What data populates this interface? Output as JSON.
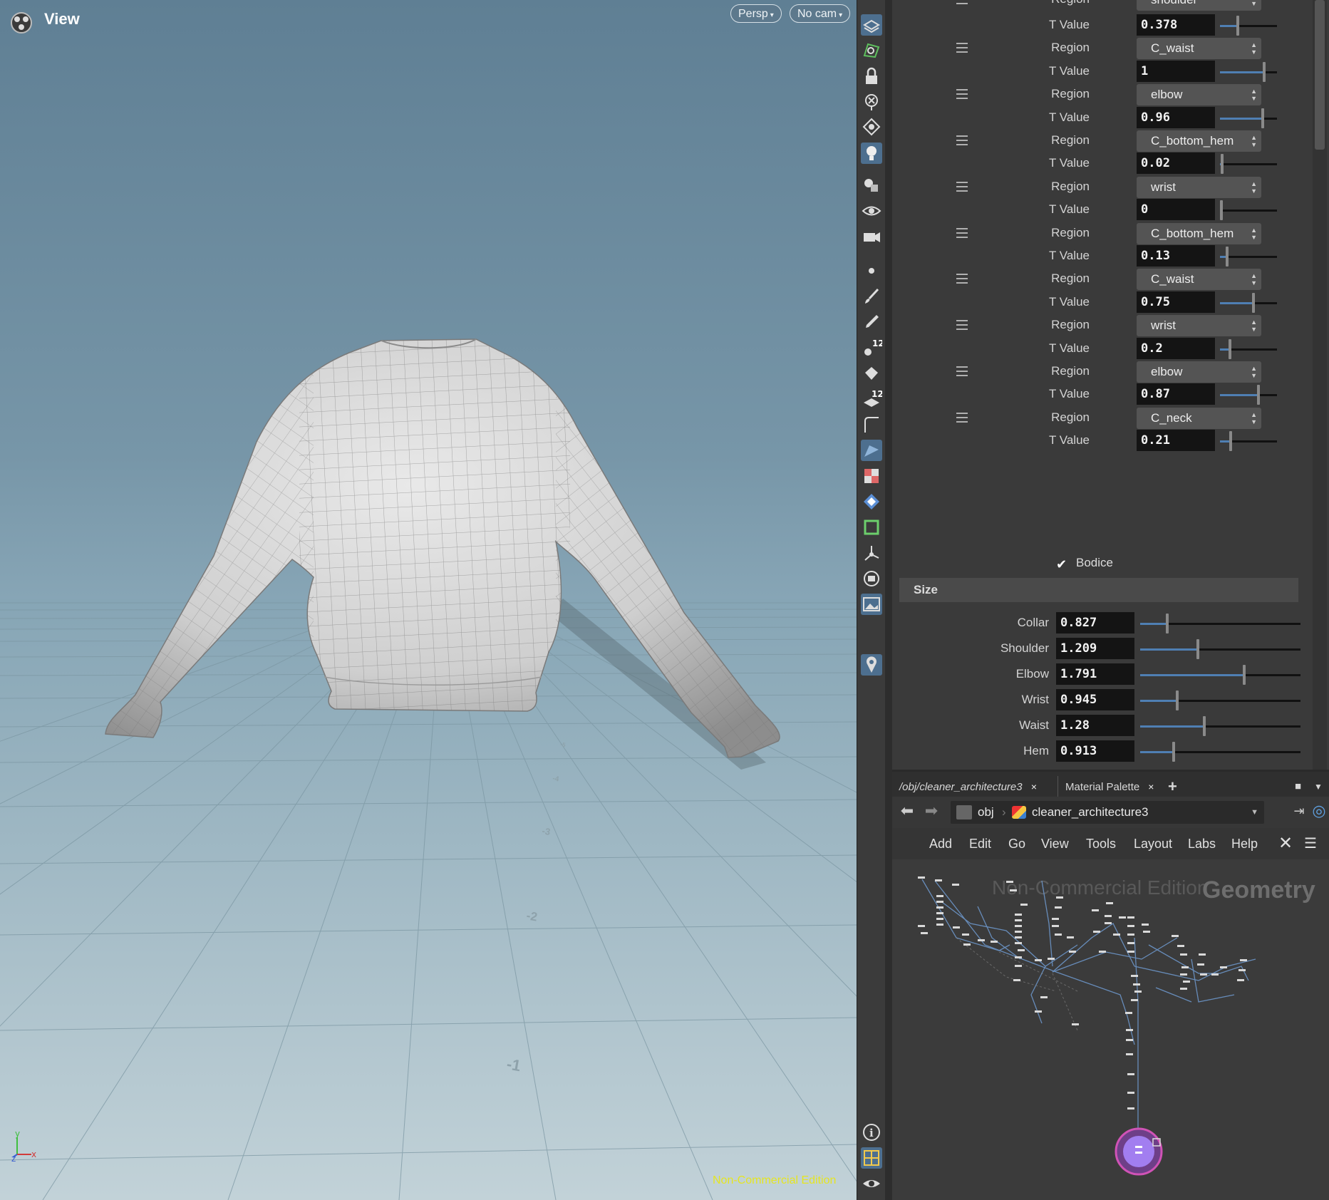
{
  "viewport": {
    "title": "View",
    "persp_label": "Persp",
    "cam_label": "No cam",
    "watermark": "Non-Commercial Edition",
    "axis_labels": {
      "y": "y",
      "z": "z",
      "x": "x"
    },
    "grid_numbers": [
      "-1",
      "-2",
      "-3",
      "-4",
      "-5"
    ]
  },
  "shelf": {
    "tools": [
      "select-icon",
      "view-icon",
      "lock-icon",
      "ghost-icon",
      "snap-icon",
      "light-icon",
      "geometry-icon",
      "eye-icon",
      "camera-icon",
      "point-icon",
      "brush-icon",
      "pen-icon",
      "paint-count-icon",
      "bucket-icon",
      "layer-count-icon",
      "curve-icon",
      "shader-icon",
      "checker-icon",
      "uv-icon",
      "shape-icon",
      "transform-icon",
      "render-icon",
      "image-icon",
      "pin-icon"
    ],
    "tool_counts": [
      "12",
      "12"
    ],
    "bottom_tools": [
      "info-icon",
      "layout-icon",
      "visibility-icon"
    ]
  },
  "params": {
    "rows_top_label": "shoulder",
    "regions": [
      {
        "label": "Region",
        "value": "C_waist"
      },
      {
        "label": "Region",
        "value": "elbow"
      },
      {
        "label": "Region",
        "value": "C_bottom_hem"
      },
      {
        "label": "Region",
        "value": "wrist"
      },
      {
        "label": "Region",
        "value": "C_bottom_hem"
      },
      {
        "label": "Region",
        "value": "C_waist"
      },
      {
        "label": "Region",
        "value": "wrist"
      },
      {
        "label": "Region",
        "value": "elbow"
      },
      {
        "label": "Region",
        "value": "C_neck"
      }
    ],
    "tvalues": [
      {
        "label": "T Value",
        "text": "0.378",
        "value": 0.378
      },
      {
        "label": "T Value",
        "text": "1",
        "value": 1
      },
      {
        "label": "T Value",
        "text": "0.96",
        "value": 0.96
      },
      {
        "label": "T Value",
        "text": "0.02",
        "value": 0.02
      },
      {
        "label": "T Value",
        "text": "0",
        "value": 0
      },
      {
        "label": "T Value",
        "text": "0.13",
        "value": 0.13
      },
      {
        "label": "T Value",
        "text": "0.75",
        "value": 0.75
      },
      {
        "label": "T Value",
        "text": "0.2",
        "value": 0.2
      },
      {
        "label": "T Value",
        "text": "0.87",
        "value": 0.87
      },
      {
        "label": "T Value",
        "text": "0.21",
        "value": 0.21
      }
    ],
    "bodice_label": "Bodice",
    "bodice_checked": true,
    "size_header": "Size",
    "size": [
      {
        "label": "Collar",
        "text": "0.827",
        "fraction": 0.16
      },
      {
        "label": "Shoulder",
        "text": "1.209",
        "fraction": 0.35
      },
      {
        "label": "Elbow",
        "text": "1.791",
        "fraction": 0.64
      },
      {
        "label": "Wrist",
        "text": "0.945",
        "fraction": 0.22
      },
      {
        "label": "Waist",
        "text": "1.28",
        "fraction": 0.39
      },
      {
        "label": "Hem",
        "text": "0.913",
        "fraction": 0.2
      }
    ]
  },
  "network": {
    "tabs": [
      "/obj/cleaner_architecture3",
      "Material Palette"
    ],
    "tab_close": "×",
    "add_tab": "+",
    "path_root": "obj",
    "path_node": "cleaner_architecture3",
    "menus": [
      "Add",
      "Edit",
      "Go",
      "View",
      "Tools",
      "Layout",
      "Labs",
      "Help"
    ],
    "watermark": "Non-Commercial Edition",
    "context_label": "Geometry"
  },
  "colors": {
    "accent": "#4f7fb3",
    "watermark_yellow": "#e5e522",
    "node_purple": "#9b6ee8",
    "wire_blue": "#6f9bd1"
  }
}
